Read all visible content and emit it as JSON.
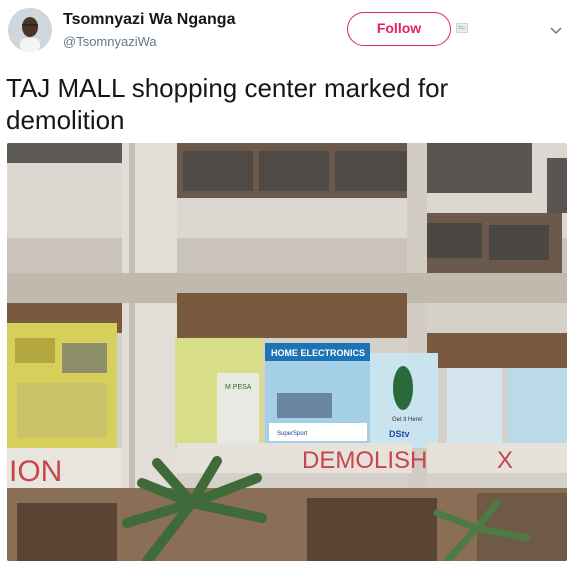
{
  "author": {
    "name": "Tsomnyazi Wa Nganga",
    "handle": "@TsomnyaziWa",
    "avatar_icon": "avatar"
  },
  "actions": {
    "follow_label": "Follow",
    "follow_color": "#e0245e"
  },
  "tweet": {
    "text": "TAJ MALL shopping center marked for demolition"
  },
  "photo": {
    "signs": {
      "home_electronics": "HOME ELECTRONICS",
      "mpesa": "M PESA",
      "dstv": "DStv",
      "supersport": "SuperSport",
      "get_it_here": "Get it Here!"
    },
    "graffiti": {
      "left": "ION",
      "center": "DEMOLISH",
      "right": "X"
    }
  }
}
